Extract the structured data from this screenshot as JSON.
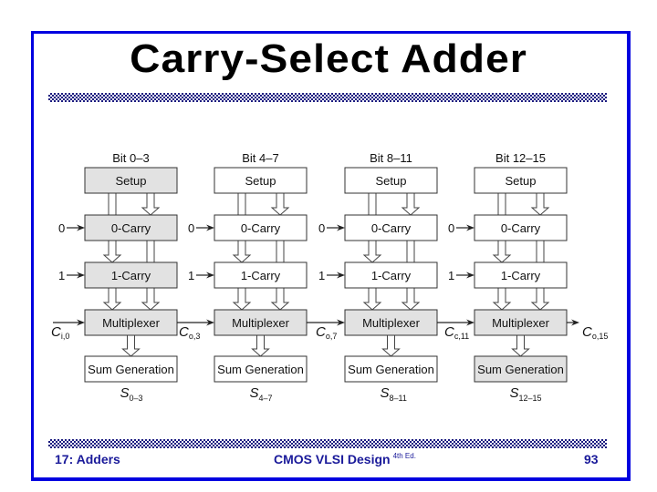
{
  "slide": {
    "title": "Carry-Select Adder",
    "footer": {
      "chapter": "17: Adders",
      "course": "CMOS VLSI Design",
      "edition": "4th Ed.",
      "page": "93"
    },
    "colors": {
      "frame": "#0000e0",
      "footer_text": "#1a1a9a",
      "shaded_box": "#e2e2e2",
      "plain_box": "#ffffff"
    }
  },
  "diagram": {
    "row_labels": {
      "setup": "Setup",
      "zero_carry": "0-Carry",
      "one_carry": "1-Carry",
      "mux": "Multiplexer",
      "sum": "Sum Generation"
    },
    "carry_inputs": {
      "zero": "0",
      "one": "1"
    },
    "blocks": [
      {
        "bits": "Bit 0–3",
        "sum_main": "S",
        "sum_sub": "0–3",
        "shaded": {
          "setup": true,
          "zero_carry": true,
          "one_carry": true,
          "mux": true,
          "sum": false
        }
      },
      {
        "bits": "Bit 4–7",
        "sum_main": "S",
        "sum_sub": "4–7",
        "shaded": {
          "setup": false,
          "zero_carry": false,
          "one_carry": false,
          "mux": true,
          "sum": false
        }
      },
      {
        "bits": "Bit 8–11",
        "sum_main": "S",
        "sum_sub": "8–11",
        "shaded": {
          "setup": false,
          "zero_carry": false,
          "one_carry": false,
          "mux": true,
          "sum": false
        }
      },
      {
        "bits": "Bit 12–15",
        "sum_main": "S",
        "sum_sub": "12–15",
        "shaded": {
          "setup": false,
          "zero_carry": false,
          "one_carry": false,
          "mux": true,
          "sum": true
        }
      }
    ],
    "carry_signals": [
      {
        "main": "C",
        "sub": "i,0"
      },
      {
        "main": "C",
        "sub": "o,3"
      },
      {
        "main": "C",
        "sub": "o,7"
      },
      {
        "main": "C",
        "sub": "c,11"
      },
      {
        "main": "C",
        "sub": "o,15"
      }
    ]
  }
}
